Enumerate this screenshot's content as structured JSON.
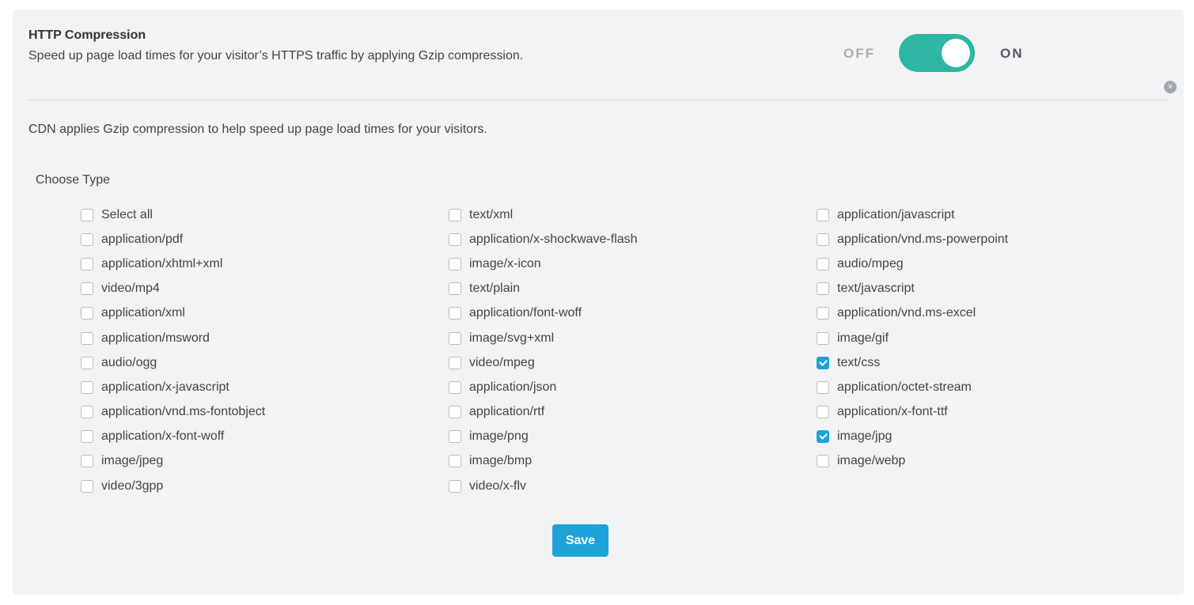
{
  "header": {
    "title": "HTTP Compression",
    "description": "Speed up page load times for your visitor’s HTTPS traffic by applying Gzip compression."
  },
  "toggle": {
    "off_label": "OFF",
    "on_label": "ON",
    "state": "on",
    "color": "#2db6a3"
  },
  "close_icon": "close-icon",
  "note": "CDN applies Gzip compression to help speed up page load times for your visitors.",
  "choose_type_label": "Choose Type",
  "columns": [
    [
      {
        "label": "Select all",
        "checked": false
      },
      {
        "label": "application/pdf",
        "checked": false
      },
      {
        "label": "application/xhtml+xml",
        "checked": false
      },
      {
        "label": "video/mp4",
        "checked": false
      },
      {
        "label": "application/xml",
        "checked": false
      },
      {
        "label": "application/msword",
        "checked": false
      },
      {
        "label": "audio/ogg",
        "checked": false
      },
      {
        "label": "application/x-javascript",
        "checked": false
      },
      {
        "label": "application/vnd.ms-fontobject",
        "checked": false
      },
      {
        "label": "application/x-font-woff",
        "checked": false
      },
      {
        "label": "image/jpeg",
        "checked": false
      },
      {
        "label": "video/3gpp",
        "checked": false
      }
    ],
    [
      {
        "label": "text/xml",
        "checked": false
      },
      {
        "label": "application/x-shockwave-flash",
        "checked": false
      },
      {
        "label": "image/x-icon",
        "checked": false
      },
      {
        "label": "text/plain",
        "checked": false
      },
      {
        "label": "application/font-woff",
        "checked": false
      },
      {
        "label": "image/svg+xml",
        "checked": false
      },
      {
        "label": "video/mpeg",
        "checked": false
      },
      {
        "label": "application/json",
        "checked": false
      },
      {
        "label": "application/rtf",
        "checked": false
      },
      {
        "label": "image/png",
        "checked": false
      },
      {
        "label": "image/bmp",
        "checked": false
      },
      {
        "label": "video/x-flv",
        "checked": false
      }
    ],
    [
      {
        "label": "application/javascript",
        "checked": false
      },
      {
        "label": "application/vnd.ms-powerpoint",
        "checked": false
      },
      {
        "label": "audio/mpeg",
        "checked": false
      },
      {
        "label": "text/javascript",
        "checked": false
      },
      {
        "label": "application/vnd.ms-excel",
        "checked": false
      },
      {
        "label": "image/gif",
        "checked": false
      },
      {
        "label": "text/css",
        "checked": true
      },
      {
        "label": "application/octet-stream",
        "checked": false
      },
      {
        "label": "application/x-font-ttf",
        "checked": false
      },
      {
        "label": "image/jpg",
        "checked": true
      },
      {
        "label": "image/webp",
        "checked": false
      }
    ]
  ],
  "save_label": "Save",
  "accent_color": "#1ea3d8"
}
